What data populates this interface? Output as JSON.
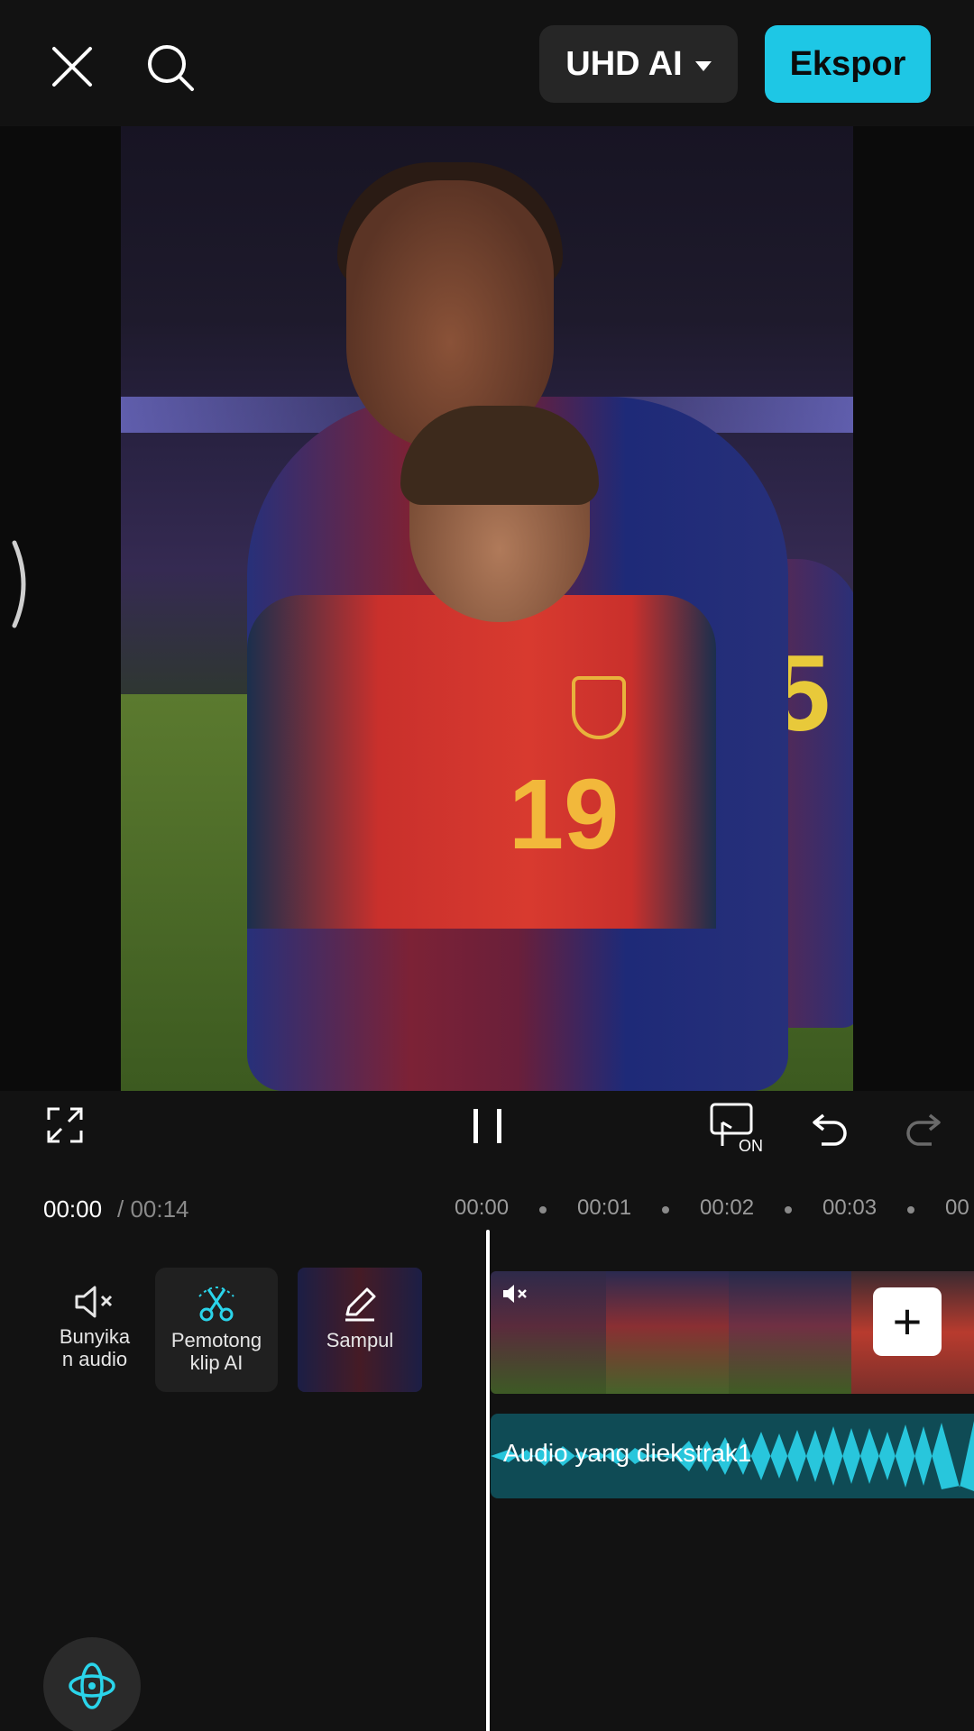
{
  "header": {
    "quality_label": "UHD AI",
    "export_label": "Ekspor"
  },
  "player": {
    "current_time": "00:00",
    "total_time": "/ 00:14"
  },
  "ruler": {
    "ticks": [
      "00:00",
      "00:01",
      "00:02",
      "00:03",
      "00"
    ]
  },
  "tools": {
    "mute_label": "Bunyikan audio",
    "cutter_label": "Pemotong klip AI",
    "cover_label": "Sampul"
  },
  "tracks": {
    "audio_label": "Audio yang diekstrak1"
  },
  "colors": {
    "accent": "#1ec7e5",
    "background": "#121212",
    "audio_track": "#0f4b55"
  },
  "icons": [
    "close-icon",
    "search-icon",
    "fullscreen-icon",
    "pause-icon",
    "keyframe-on-icon",
    "undo-icon",
    "redo-icon",
    "mute-icon",
    "ai-cutter-icon",
    "edit-icon",
    "plus-icon",
    "ai-assistant-icon"
  ]
}
